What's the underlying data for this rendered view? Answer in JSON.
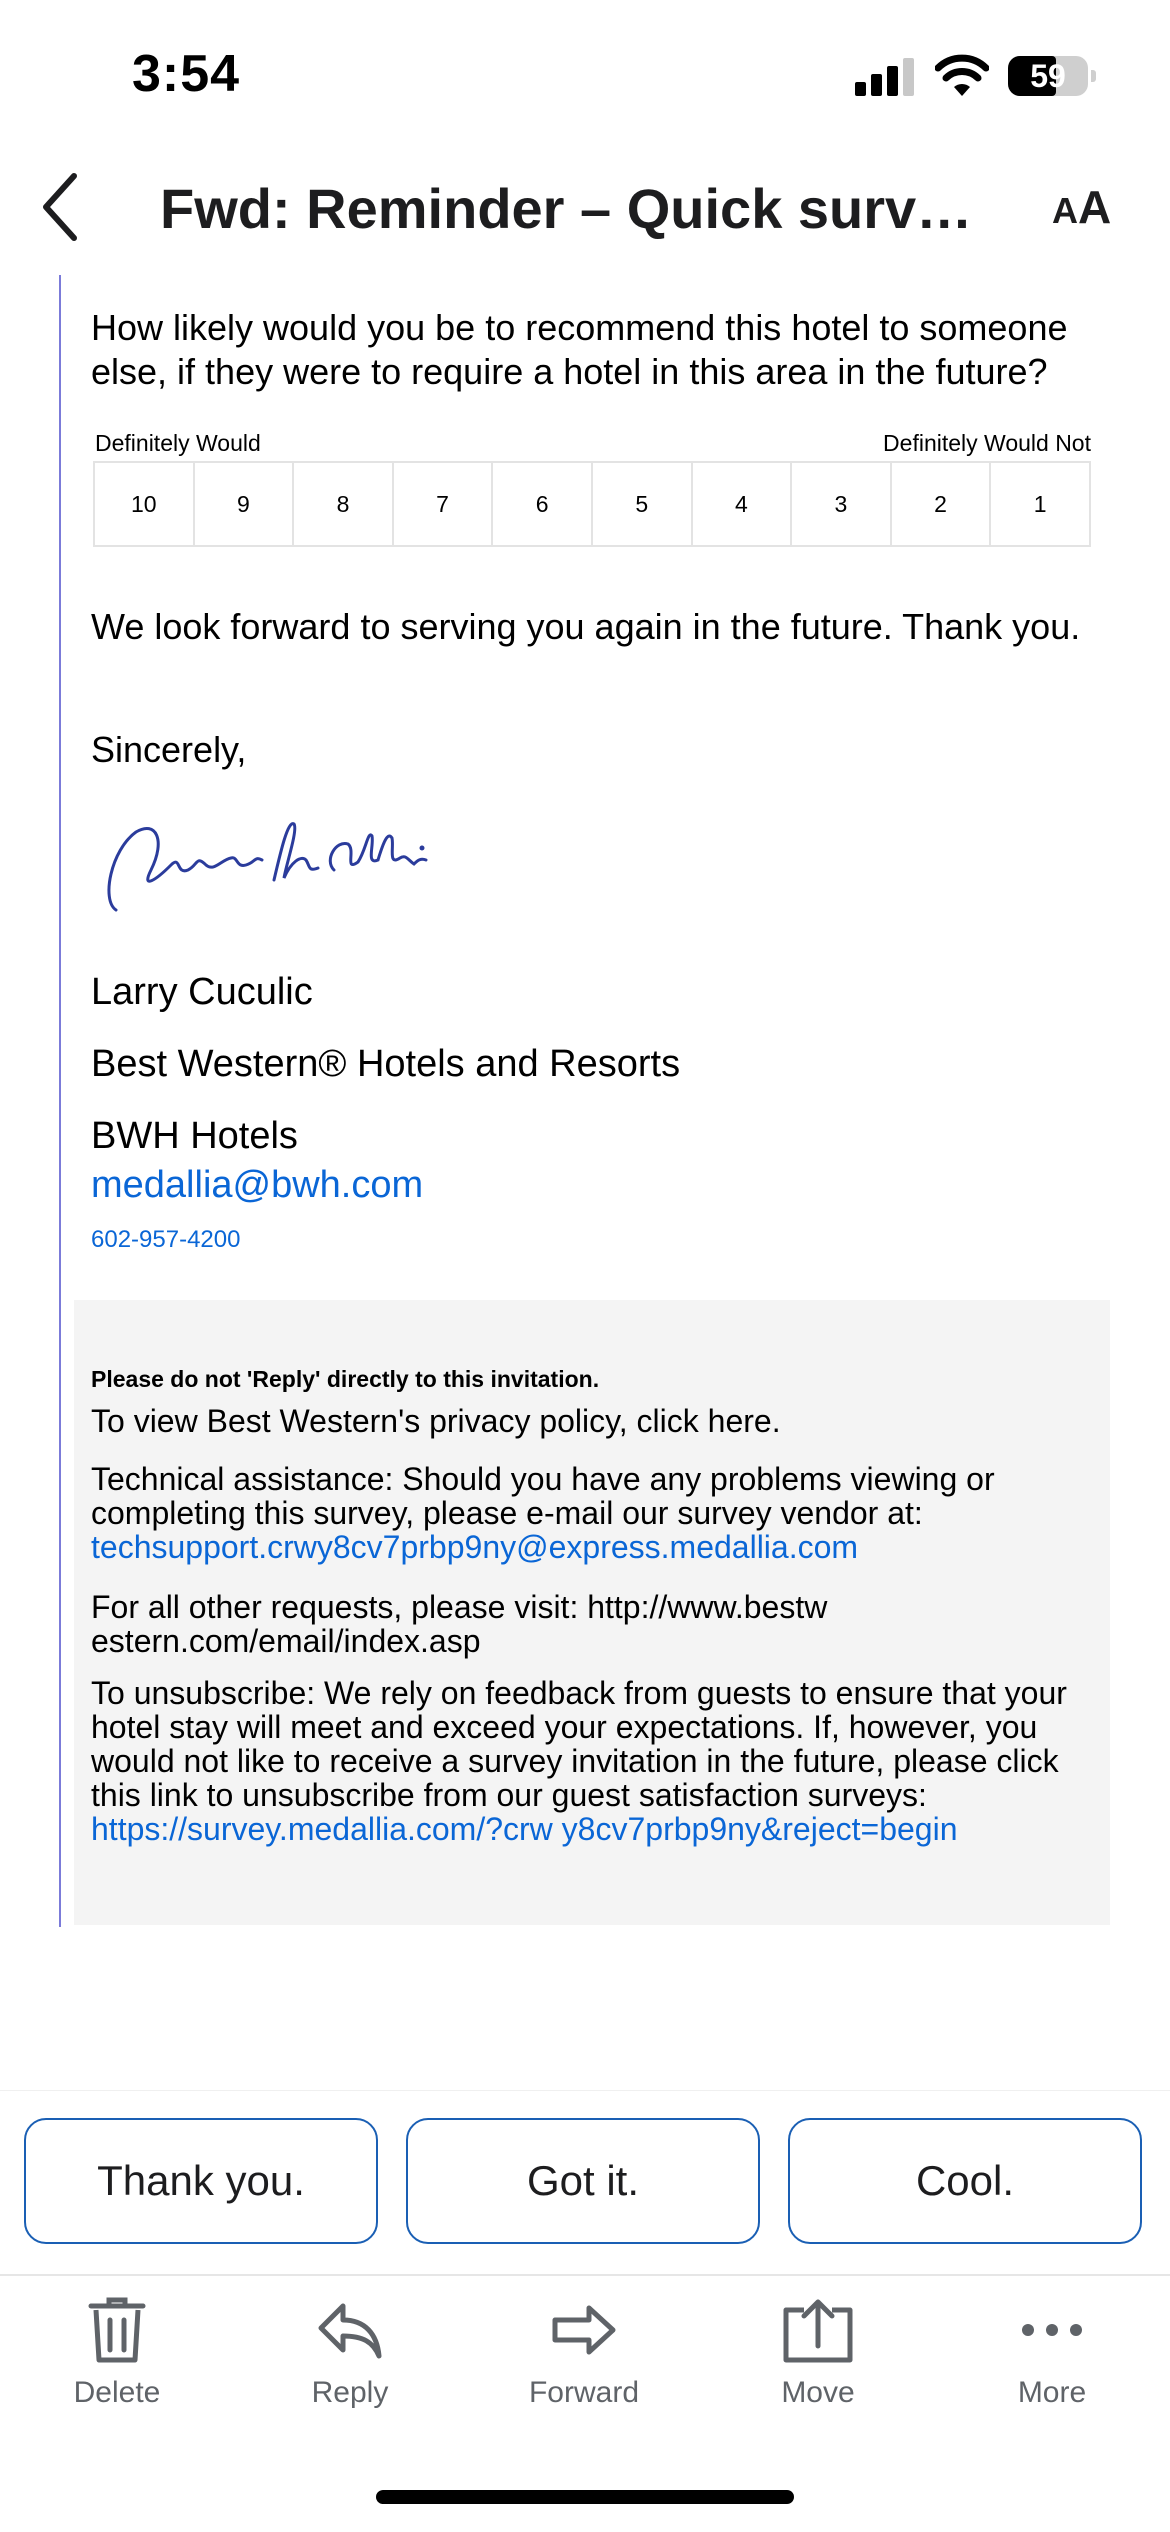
{
  "status": {
    "time": "3:54",
    "battery": "59"
  },
  "header": {
    "title": "Fwd: Reminder – Quick survey –...",
    "text_size_label": "A",
    "text_size_label_big": "A"
  },
  "email": {
    "question": "How likely would you be to recommend this hotel to someone else, if they were to require a hotel in this area in the future?",
    "scale_left": "Definitely Would",
    "scale_right": "Definitely Would Not",
    "scale": [
      "10",
      "9",
      "8",
      "7",
      "6",
      "5",
      "4",
      "3",
      "2",
      "1"
    ],
    "closing": "We look forward to serving you again in the future. Thank you.",
    "sincerely": "Sincerely,",
    "signer_name": "Larry Cuculic",
    "signer_company": "Best Western® Hotels and Resorts",
    "signer_group": "BWH Hotels",
    "email_link": "medallia@bwh.com",
    "phone": "602-957-4200"
  },
  "footer": {
    "do_not_reply": "Please do not 'Reply' directly to this invitation.",
    "privacy": "To view Best Western's privacy policy, click here.",
    "tech_text": "Technical assistance: Should you have any problems viewing or completing this survey, please e-mail our survey vendor at: ",
    "tech_link": "techsupport.crwy8cv7prbp9ny@express.medallia.com",
    "other_requests": "For all other requests, please visit: http://www.bestw estern.com/email/index.asp",
    "unsub_text": "To unsubscribe: We rely on feedback from guests to ensure that your hotel stay will meet and exceed your expectations. If, however, you would not like to receive a survey invitation in the future, please click this link to unsubscribe from our guest satisfaction surveys: ",
    "unsub_link": "https://survey.medallia.com/?crw y8cv7prbp9ny&reject=begin"
  },
  "smart_replies": [
    "Thank you.",
    "Got it.",
    "Cool."
  ],
  "toolbar": {
    "delete": "Delete",
    "reply": "Reply",
    "forward": "Forward",
    "move": "Move",
    "more": "More"
  },
  "icons": {
    "back": "chevron-left-icon",
    "text_size": "text-size-icon",
    "delete": "trash-icon",
    "reply": "reply-arrow-icon",
    "forward": "forward-arrow-icon",
    "move": "move-to-folder-icon",
    "more": "ellipsis-icon"
  },
  "colors": {
    "link": "#0a66d6",
    "chip_border": "#1a5fb4",
    "quote_bar": "#7b7bd9",
    "toolbar_icon": "#5f6368"
  }
}
